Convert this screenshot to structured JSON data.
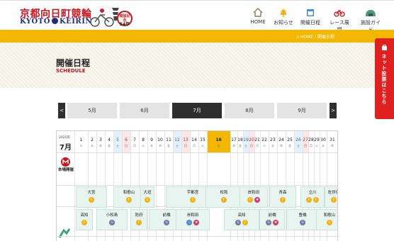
{
  "header": {
    "logo_jp": "京都向日町競輪",
    "logo_en_left": "KYOTO",
    "logo_en_right": "KEIRIN",
    "badge_line1": "開設記念",
    "badge_line2": "54年",
    "nav": [
      {
        "label": "HOME",
        "icon": "home-icon"
      },
      {
        "label": "お知らせ",
        "icon": "bell-icon"
      },
      {
        "label": "開催日程",
        "icon": "calendar-icon"
      },
      {
        "label": "レース展望",
        "icon": "bicycle-icon"
      },
      {
        "label": "施設ガイド",
        "icon": "facility-icon"
      }
    ]
  },
  "breadcrumb": {
    "home": "HOME",
    "sep": "/",
    "current": "開催日程"
  },
  "page": {
    "title": "開催日程",
    "subtitle": "SCHEDULE"
  },
  "side_banner": {
    "label": "ネット投票はこちら"
  },
  "months": {
    "prev": "<",
    "next": ">",
    "tabs": [
      "5月",
      "6月",
      "7月",
      "8月",
      "9月"
    ],
    "active": "7月"
  },
  "calendar": {
    "year": "2025年",
    "month": "7月",
    "home_label": "本場開催",
    "days": [
      {
        "d": "1",
        "w": "火"
      },
      {
        "d": "2",
        "w": "水"
      },
      {
        "d": "3",
        "w": "木"
      },
      {
        "d": "4",
        "w": "金"
      },
      {
        "d": "5",
        "w": "土"
      },
      {
        "d": "6",
        "w": "日"
      },
      {
        "d": "7",
        "w": "月"
      },
      {
        "d": "8",
        "w": "火"
      },
      {
        "d": "9",
        "w": "水"
      },
      {
        "d": "10",
        "w": "木"
      },
      {
        "d": "11",
        "w": "金"
      },
      {
        "d": "12",
        "w": "土"
      },
      {
        "d": "13",
        "w": "日"
      },
      {
        "d": "14",
        "w": "月"
      },
      {
        "d": "15",
        "w": "火"
      },
      {
        "d": "16",
        "w": "水"
      },
      {
        "d": "17",
        "w": "木"
      },
      {
        "d": "18",
        "w": "金"
      },
      {
        "d": "19",
        "w": "土"
      },
      {
        "d": "20",
        "w": "日"
      },
      {
        "d": "21",
        "w": "月"
      },
      {
        "d": "22",
        "w": "火"
      },
      {
        "d": "23",
        "w": "水"
      },
      {
        "d": "24",
        "w": "木"
      },
      {
        "d": "25",
        "w": "金"
      },
      {
        "d": "26",
        "w": "土"
      },
      {
        "d": "27",
        "w": "日"
      },
      {
        "d": "28",
        "w": "月"
      },
      {
        "d": "29",
        "w": "火"
      },
      {
        "d": "30",
        "w": "水"
      },
      {
        "d": "31",
        "w": "木"
      }
    ],
    "today": "16",
    "venues_row1": [
      "大宮",
      "和歌山",
      "大垣",
      "宇都宮",
      "松阪",
      "岸和田",
      "青森",
      "立川",
      "佐世保"
    ],
    "venues_row2": [
      "高知",
      "小松島",
      "防府",
      "前橋",
      "岸和田",
      "高知",
      "前橋",
      "豊橋",
      "和歌山"
    ],
    "colors": {
      "saturday": "#2b6cc4",
      "sunday": "#d0283a",
      "today": "#f3b700",
      "accent": "#c8151e"
    }
  }
}
